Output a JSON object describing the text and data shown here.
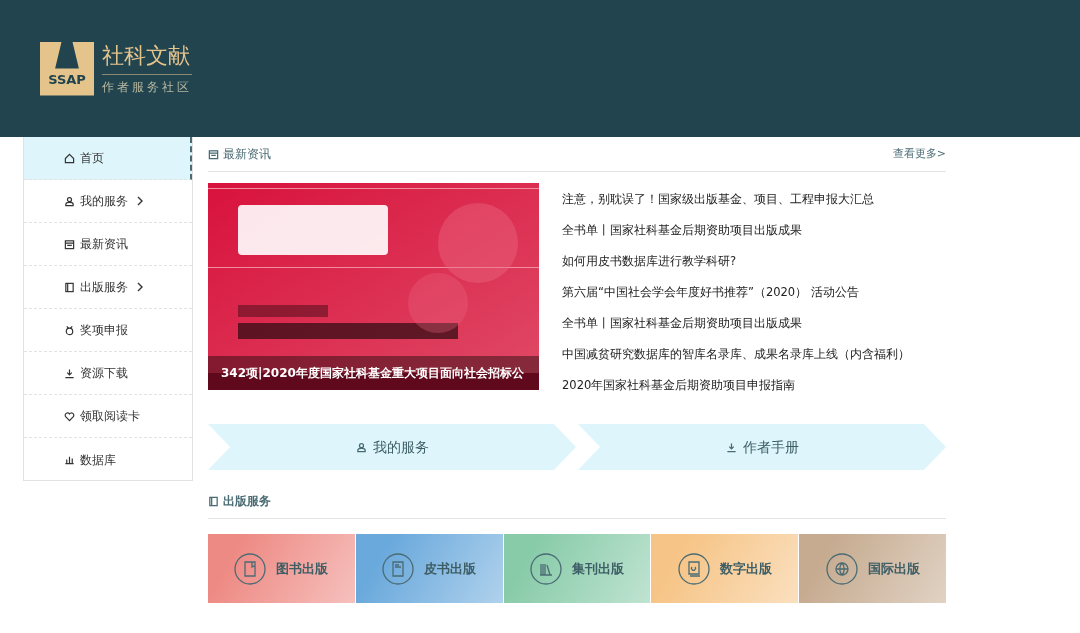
{
  "header": {
    "logo_mark": "SSAP",
    "logo_title": "社科文献",
    "logo_subtitle": "作者服务社区"
  },
  "sidebar": {
    "items": [
      {
        "label": "首页",
        "selected": true,
        "has_submenu": false
      },
      {
        "label": "我的服务",
        "selected": false,
        "has_submenu": true
      },
      {
        "label": "最新资讯",
        "selected": false,
        "has_submenu": false
      },
      {
        "label": "出版服务",
        "selected": false,
        "has_submenu": true
      },
      {
        "label": "奖项申报",
        "selected": false,
        "has_submenu": false
      },
      {
        "label": "资源下载",
        "selected": false,
        "has_submenu": false
      },
      {
        "label": "领取阅读卡",
        "selected": false,
        "has_submenu": false
      },
      {
        "label": "数据库",
        "selected": false,
        "has_submenu": false
      }
    ]
  },
  "news": {
    "title": "最新资讯",
    "more_link": "查看更多>",
    "featured": {
      "kind": "picture",
      "caption": "342项|2020年度国家社科基金重大项目面向社会招标公"
    },
    "items": [
      "注意，别耽误了！国家级出版基金、项目、工程申报大汇总",
      "全书单丨国家社科基金后期资助项目出版成果",
      "如何用皮书数据库进行教学科研?",
      "第六届“中国社会学会年度好书推荐”（2020） 活动公告",
      "全书单丨国家社科基金后期资助项目出版成果",
      "中国减贫研究数据库的智库名录库、成果名录库上线（内含福利）",
      "2020年国家社科基金后期资助项目申报指南"
    ]
  },
  "quick_links": [
    "我的服务",
    "作者手册"
  ],
  "publishing": {
    "title": "出版服务",
    "cards": [
      {
        "label": "图书出版",
        "color": "#ee8a84"
      },
      {
        "label": "皮书出版",
        "color": "#6aa9dc"
      },
      {
        "label": "集刊出版",
        "color": "#88cba9"
      },
      {
        "label": "数字出版",
        "color": "#f6c486"
      },
      {
        "label": "国际出版",
        "color": "#c6ab90"
      }
    ]
  }
}
